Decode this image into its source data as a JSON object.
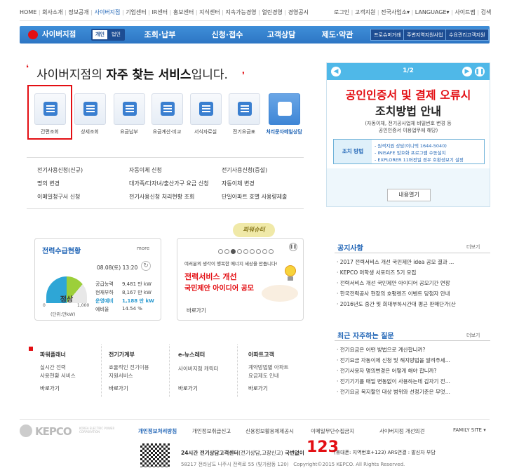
{
  "top_nav": {
    "left": [
      "HOME",
      "회사소개",
      "정보공개",
      "사이버지점",
      "기업센터",
      "IR센터",
      "홍보센터",
      "지식센터",
      "지속가능경영",
      "열린경영",
      "경영공시"
    ],
    "right": [
      "로그인",
      "고객지원",
      "전국사업소",
      "LANGUAGE",
      "사이트맵",
      "검색"
    ]
  },
  "gnb": {
    "brand": "사이버지점",
    "toggle": [
      "개인",
      "법인"
    ],
    "tabs": [
      "조회·납부",
      "신청·접수",
      "고객상담",
      "제도·약관"
    ],
    "buttons": [
      "프로슈머거래",
      "주변지역지원사업",
      "수요관리고객지원"
    ]
  },
  "headline": {
    "prefix": "사이버지점의 ",
    "strong": "자주 찾는 서비스",
    "suffix": "입니다."
  },
  "services": [
    "간편조회",
    "상세조회",
    "요금납부",
    "요금계산·비교",
    "서식자료실",
    "전기요금표",
    "처리문자메일상담"
  ],
  "links": [
    [
      "전기사용신청(신규)",
      "자동이체 신청",
      "전기사용신청(증설)"
    ],
    [
      "명의 변경",
      "대가족/다자녀/출산가구 요금 신청",
      "자동이체 변경"
    ],
    [
      "이메일청구서 신청",
      "전기사용신청 처리현황 조회",
      "단일아파트 호별 사용량제출"
    ]
  ],
  "banner": {
    "page": "1/2",
    "title": "공인인증서 및 결제 오류시",
    "subtitle": "조치방법 안내",
    "desc1": "(자동이체, 전기공사업체 비밀번호 변경 등",
    "desc2": "공인인증서 이용업무에 해당)",
    "label": "조치 방법",
    "items": [
      "- 원격지원 상담(이니텍 1644-5040)",
      "- INISAFE 암호화 프로그램 수동설치",
      "- EXPLORER 11버전일 경우 호환성보기 설정"
    ],
    "button": "내용열기"
  },
  "power": {
    "title": "전력수급현황",
    "more": "more",
    "datetime": "08.08(토) 13:20",
    "rows": [
      [
        "공급능력",
        "9,481 만 kW"
      ],
      [
        "현재부하",
        "8,167 만 kW"
      ],
      [
        "운영예비",
        "1,188 만 kW"
      ],
      [
        "예비율",
        "14.54 %"
      ]
    ],
    "status": "정상",
    "gauge_min": "0",
    "gauge_max": "1,000",
    "unit": "(단위:만kW)"
  },
  "promo": {
    "caption": "여러분의 생각이 행복한 에너지 세상을 만듭니다!",
    "line1": "전력서비스 개선",
    "line2": "국민제안 아이디어 공모",
    "more": "바로가기",
    "badge": "파워슈터"
  },
  "notice": {
    "title": "공지사항",
    "more": "더보기",
    "items": [
      "2017 전력서비스 개선 국민제안 idea 공모 결과 ...",
      "KEPCO 머학생 서포터즈 5기 모집",
      "전력서비스 개선 국민제안 아이디어 공모기간 연장",
      "한국전력공사 현장의 호평렌즈 이벤트 당첨자 안내",
      "2016년도 중간 및 희대부하시간대 평균 판매단가(산"
    ]
  },
  "faq": {
    "title": "최근 자주하는 질문",
    "more": "더보기",
    "items": [
      "전기요금은 어떤 방법으로 계산합니까?",
      "전기요금 자동이체 신청 및 해지방법을 알려주세...",
      "전기사용자 명의변경은 어떻게 해야 합니까?",
      "전기기기를 매일 변동없이 사용하는데 갑자기 전...",
      "전기요금 복지할인 대상 범위와 선정기준은 무엇..."
    ]
  },
  "bottom": [
    {
      "title": "파워플래너",
      "lines": [
        "실시간 전력",
        "사용현황 서비스"
      ],
      "more": "바로가기"
    },
    {
      "title": "전기가계부",
      "lines": [
        "효율적인 전기이용",
        "지원서비스"
      ],
      "more": "바로가기"
    },
    {
      "title": "e-뉴스레터",
      "lines": [
        "사이버지점 캐릭터"
      ],
      "more": "바로가기"
    },
    {
      "title": "아파트고객",
      "lines": [
        "계약방법별 아파트",
        "요금제도 안내"
      ],
      "more": "바로가기"
    }
  ],
  "footer": {
    "logo": "KEPCO",
    "logo_sub": "KOREA ELECTRIC POWER CORPORATION",
    "links": [
      "개인정보처리방침",
      "개인정보취급신고",
      "신용정보활용체제공시",
      "이메일무단수집금지",
      "사이버지점 개선의견"
    ],
    "family": "FAMILY SITE",
    "callcenter": "24시간 전기상담고객센터",
    "callcenter_note": "(전기상담,고장신고)",
    "number_label": "국번없이",
    "number": "123",
    "number_note": "(휴대폰: 지역번호+123) ARS연결 : 발신자 부담",
    "address": "58217 전라남도 나주시 전력로 55 (빛가람동 120)",
    "copyright": "Copyright©2015 KEPCO. All Rights Reserved."
  },
  "colors": {
    "primary": "#2d76c4",
    "accent_red": "#e30e13",
    "highlight": "#1e63b5"
  }
}
